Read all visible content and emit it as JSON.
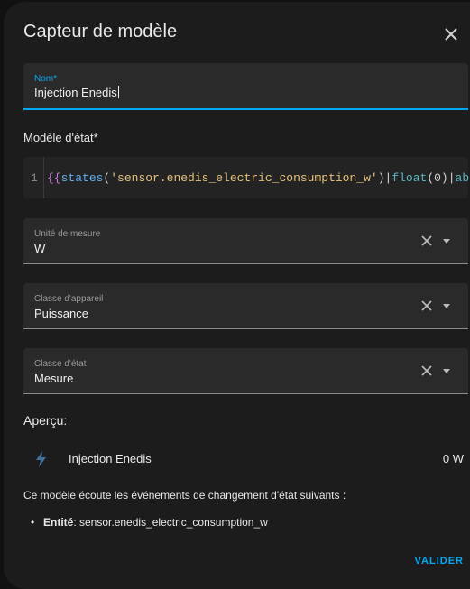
{
  "dialog": {
    "title": "Capteur de modèle",
    "close_icon": "close-icon"
  },
  "name_field": {
    "label": "Nom*",
    "value": "Injection Enedis",
    "accent": "#03a9f4"
  },
  "state_template": {
    "label": "Modèle d'état*",
    "line_number": "1",
    "tokens": {
      "open": "{{",
      "fn": "states",
      "paren_open": "(",
      "string": "'sensor.enedis_electric_consumption_w'",
      "paren_close": ")",
      "pipe1": "|",
      "float": "float",
      "float_arg": "(0)",
      "pipe2": "|",
      "abs": "abs",
      "close": "}}"
    }
  },
  "unit_field": {
    "label": "Unité de mesure",
    "value": "W"
  },
  "device_class_field": {
    "label": "Classe d'appareil",
    "value": "Puissance"
  },
  "state_class_field": {
    "label": "Classe d'état",
    "value": "Mesure"
  },
  "preview": {
    "label": "Aperçu:",
    "icon": "lightning-bolt-icon",
    "entity_name": "Injection Enedis",
    "value": "0 W"
  },
  "listening": {
    "text": "Ce modèle écoute les événements de changement d'état suivants :",
    "entity_label": "Entité",
    "entity_value": ": sensor.enedis_electric_consumption_w"
  },
  "actions": {
    "validate_label": "VALIDER"
  },
  "colors": {
    "accent": "#03a9f4",
    "background": "#1c1c1c",
    "field": "#2a2a2a"
  }
}
